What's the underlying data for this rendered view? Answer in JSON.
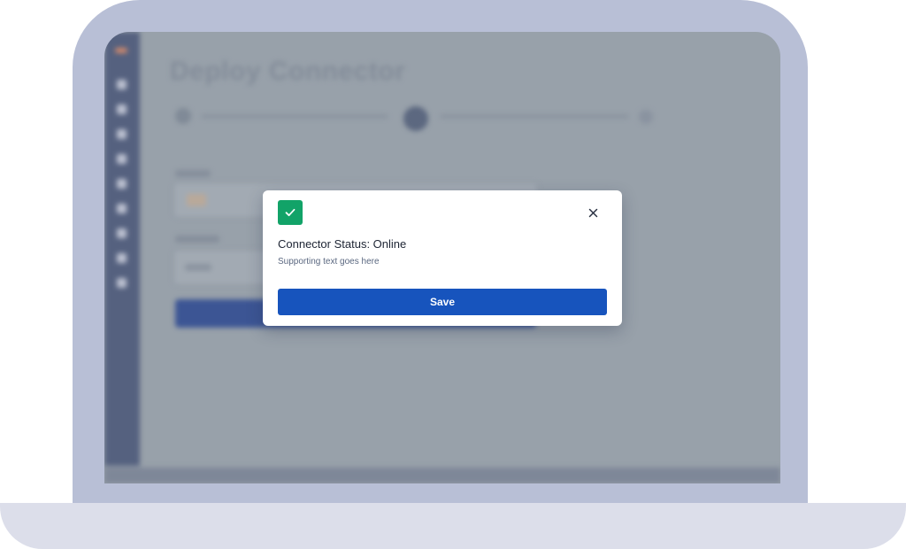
{
  "background_app": {
    "title": "Deploy Connector"
  },
  "modal": {
    "status_icon": "check-icon",
    "title": "Connector Status: Online",
    "subtitle": "Supporting text goes here",
    "close_icon": "close-icon",
    "save_label": "Save"
  },
  "colors": {
    "laptop_frame": "#b8bfd6",
    "laptop_base": "#dcdeea",
    "success_accent": "#12a368",
    "primary_button": "#1754bd"
  }
}
